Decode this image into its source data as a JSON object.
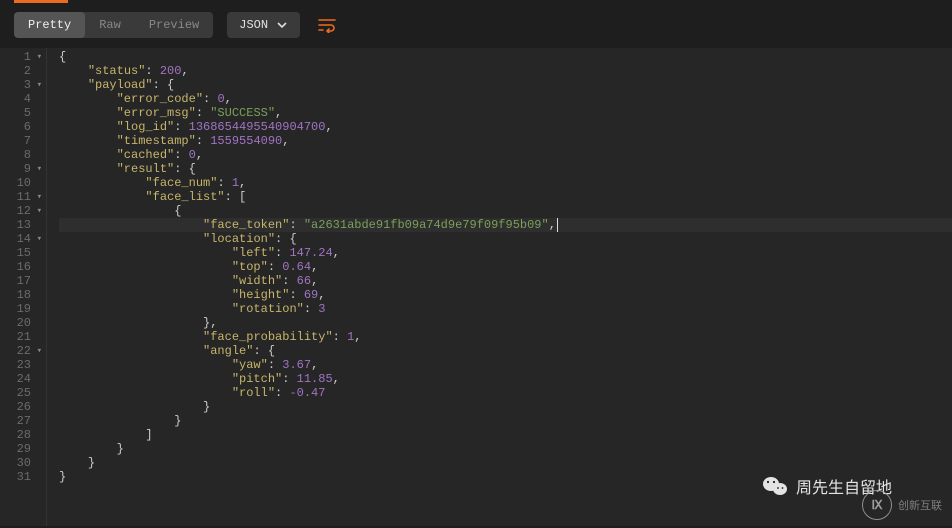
{
  "toolbar": {
    "tabs": [
      "Pretty",
      "Raw",
      "Preview"
    ],
    "active_tab": 0,
    "format_label": "JSON"
  },
  "editor": {
    "highlighted_line": 13,
    "lines": [
      {
        "n": 1,
        "fold": true,
        "indent": 0,
        "tokens": [
          {
            "t": "p",
            "v": "{"
          }
        ]
      },
      {
        "n": 2,
        "fold": false,
        "indent": 1,
        "tokens": [
          {
            "t": "k",
            "v": "\"status\""
          },
          {
            "t": "p",
            "v": ": "
          },
          {
            "t": "n",
            "v": "200"
          },
          {
            "t": "p",
            "v": ","
          }
        ]
      },
      {
        "n": 3,
        "fold": true,
        "indent": 1,
        "tokens": [
          {
            "t": "k",
            "v": "\"payload\""
          },
          {
            "t": "p",
            "v": ": {"
          }
        ]
      },
      {
        "n": 4,
        "fold": false,
        "indent": 2,
        "tokens": [
          {
            "t": "k",
            "v": "\"error_code\""
          },
          {
            "t": "p",
            "v": ": "
          },
          {
            "t": "n",
            "v": "0"
          },
          {
            "t": "p",
            "v": ","
          }
        ]
      },
      {
        "n": 5,
        "fold": false,
        "indent": 2,
        "tokens": [
          {
            "t": "k",
            "v": "\"error_msg\""
          },
          {
            "t": "p",
            "v": ": "
          },
          {
            "t": "s",
            "v": "\"SUCCESS\""
          },
          {
            "t": "p",
            "v": ","
          }
        ]
      },
      {
        "n": 6,
        "fold": false,
        "indent": 2,
        "tokens": [
          {
            "t": "k",
            "v": "\"log_id\""
          },
          {
            "t": "p",
            "v": ": "
          },
          {
            "t": "n",
            "v": "1368654495540904700"
          },
          {
            "t": "p",
            "v": ","
          }
        ]
      },
      {
        "n": 7,
        "fold": false,
        "indent": 2,
        "tokens": [
          {
            "t": "k",
            "v": "\"timestamp\""
          },
          {
            "t": "p",
            "v": ": "
          },
          {
            "t": "n",
            "v": "1559554090"
          },
          {
            "t": "p",
            "v": ","
          }
        ]
      },
      {
        "n": 8,
        "fold": false,
        "indent": 2,
        "tokens": [
          {
            "t": "k",
            "v": "\"cached\""
          },
          {
            "t": "p",
            "v": ": "
          },
          {
            "t": "n",
            "v": "0"
          },
          {
            "t": "p",
            "v": ","
          }
        ]
      },
      {
        "n": 9,
        "fold": true,
        "indent": 2,
        "tokens": [
          {
            "t": "k",
            "v": "\"result\""
          },
          {
            "t": "p",
            "v": ": {"
          }
        ]
      },
      {
        "n": 10,
        "fold": false,
        "indent": 3,
        "tokens": [
          {
            "t": "k",
            "v": "\"face_num\""
          },
          {
            "t": "p",
            "v": ": "
          },
          {
            "t": "n",
            "v": "1"
          },
          {
            "t": "p",
            "v": ","
          }
        ]
      },
      {
        "n": 11,
        "fold": true,
        "indent": 3,
        "tokens": [
          {
            "t": "k",
            "v": "\"face_list\""
          },
          {
            "t": "p",
            "v": ": ["
          }
        ]
      },
      {
        "n": 12,
        "fold": true,
        "indent": 4,
        "tokens": [
          {
            "t": "p",
            "v": "{"
          }
        ]
      },
      {
        "n": 13,
        "fold": false,
        "indent": 5,
        "tokens": [
          {
            "t": "k",
            "v": "\"face_token\""
          },
          {
            "t": "p",
            "v": ": "
          },
          {
            "t": "s",
            "v": "\"a2631abde91fb09a74d9e79f09f95b09\""
          },
          {
            "t": "p",
            "v": ","
          },
          {
            "t": "cursor",
            "v": ""
          }
        ]
      },
      {
        "n": 14,
        "fold": true,
        "indent": 5,
        "tokens": [
          {
            "t": "k",
            "v": "\"location\""
          },
          {
            "t": "p",
            "v": ": {"
          }
        ]
      },
      {
        "n": 15,
        "fold": false,
        "indent": 6,
        "tokens": [
          {
            "t": "k",
            "v": "\"left\""
          },
          {
            "t": "p",
            "v": ": "
          },
          {
            "t": "n",
            "v": "147.24"
          },
          {
            "t": "p",
            "v": ","
          }
        ]
      },
      {
        "n": 16,
        "fold": false,
        "indent": 6,
        "tokens": [
          {
            "t": "k",
            "v": "\"top\""
          },
          {
            "t": "p",
            "v": ": "
          },
          {
            "t": "n",
            "v": "0.64"
          },
          {
            "t": "p",
            "v": ","
          }
        ]
      },
      {
        "n": 17,
        "fold": false,
        "indent": 6,
        "tokens": [
          {
            "t": "k",
            "v": "\"width\""
          },
          {
            "t": "p",
            "v": ": "
          },
          {
            "t": "n",
            "v": "66"
          },
          {
            "t": "p",
            "v": ","
          }
        ]
      },
      {
        "n": 18,
        "fold": false,
        "indent": 6,
        "tokens": [
          {
            "t": "k",
            "v": "\"height\""
          },
          {
            "t": "p",
            "v": ": "
          },
          {
            "t": "n",
            "v": "69"
          },
          {
            "t": "p",
            "v": ","
          }
        ]
      },
      {
        "n": 19,
        "fold": false,
        "indent": 6,
        "tokens": [
          {
            "t": "k",
            "v": "\"rotation\""
          },
          {
            "t": "p",
            "v": ": "
          },
          {
            "t": "n",
            "v": "3"
          }
        ]
      },
      {
        "n": 20,
        "fold": false,
        "indent": 5,
        "tokens": [
          {
            "t": "p",
            "v": "},"
          }
        ]
      },
      {
        "n": 21,
        "fold": false,
        "indent": 5,
        "tokens": [
          {
            "t": "k",
            "v": "\"face_probability\""
          },
          {
            "t": "p",
            "v": ": "
          },
          {
            "t": "n",
            "v": "1"
          },
          {
            "t": "p",
            "v": ","
          }
        ]
      },
      {
        "n": 22,
        "fold": true,
        "indent": 5,
        "tokens": [
          {
            "t": "k",
            "v": "\"angle\""
          },
          {
            "t": "p",
            "v": ": {"
          }
        ]
      },
      {
        "n": 23,
        "fold": false,
        "indent": 6,
        "tokens": [
          {
            "t": "k",
            "v": "\"yaw\""
          },
          {
            "t": "p",
            "v": ": "
          },
          {
            "t": "n",
            "v": "3.67"
          },
          {
            "t": "p",
            "v": ","
          }
        ]
      },
      {
        "n": 24,
        "fold": false,
        "indent": 6,
        "tokens": [
          {
            "t": "k",
            "v": "\"pitch\""
          },
          {
            "t": "p",
            "v": ": "
          },
          {
            "t": "n",
            "v": "11.85"
          },
          {
            "t": "p",
            "v": ","
          }
        ]
      },
      {
        "n": 25,
        "fold": false,
        "indent": 6,
        "tokens": [
          {
            "t": "k",
            "v": "\"roll\""
          },
          {
            "t": "p",
            "v": ": "
          },
          {
            "t": "n",
            "v": "-0.47"
          }
        ]
      },
      {
        "n": 26,
        "fold": false,
        "indent": 5,
        "tokens": [
          {
            "t": "p",
            "v": "}"
          }
        ]
      },
      {
        "n": 27,
        "fold": false,
        "indent": 4,
        "tokens": [
          {
            "t": "p",
            "v": "}"
          }
        ]
      },
      {
        "n": 28,
        "fold": false,
        "indent": 3,
        "tokens": [
          {
            "t": "p",
            "v": "]"
          }
        ]
      },
      {
        "n": 29,
        "fold": false,
        "indent": 2,
        "tokens": [
          {
            "t": "p",
            "v": "}"
          }
        ]
      },
      {
        "n": 30,
        "fold": false,
        "indent": 1,
        "tokens": [
          {
            "t": "p",
            "v": "}"
          }
        ]
      },
      {
        "n": 31,
        "fold": false,
        "indent": 0,
        "tokens": [
          {
            "t": "p",
            "v": "}"
          }
        ]
      }
    ],
    "indent_unit": "    "
  },
  "watermark": {
    "wechat_text": "周先生自留地",
    "brand_text": "创新互联",
    "brand_mark": "Ⅸ"
  }
}
